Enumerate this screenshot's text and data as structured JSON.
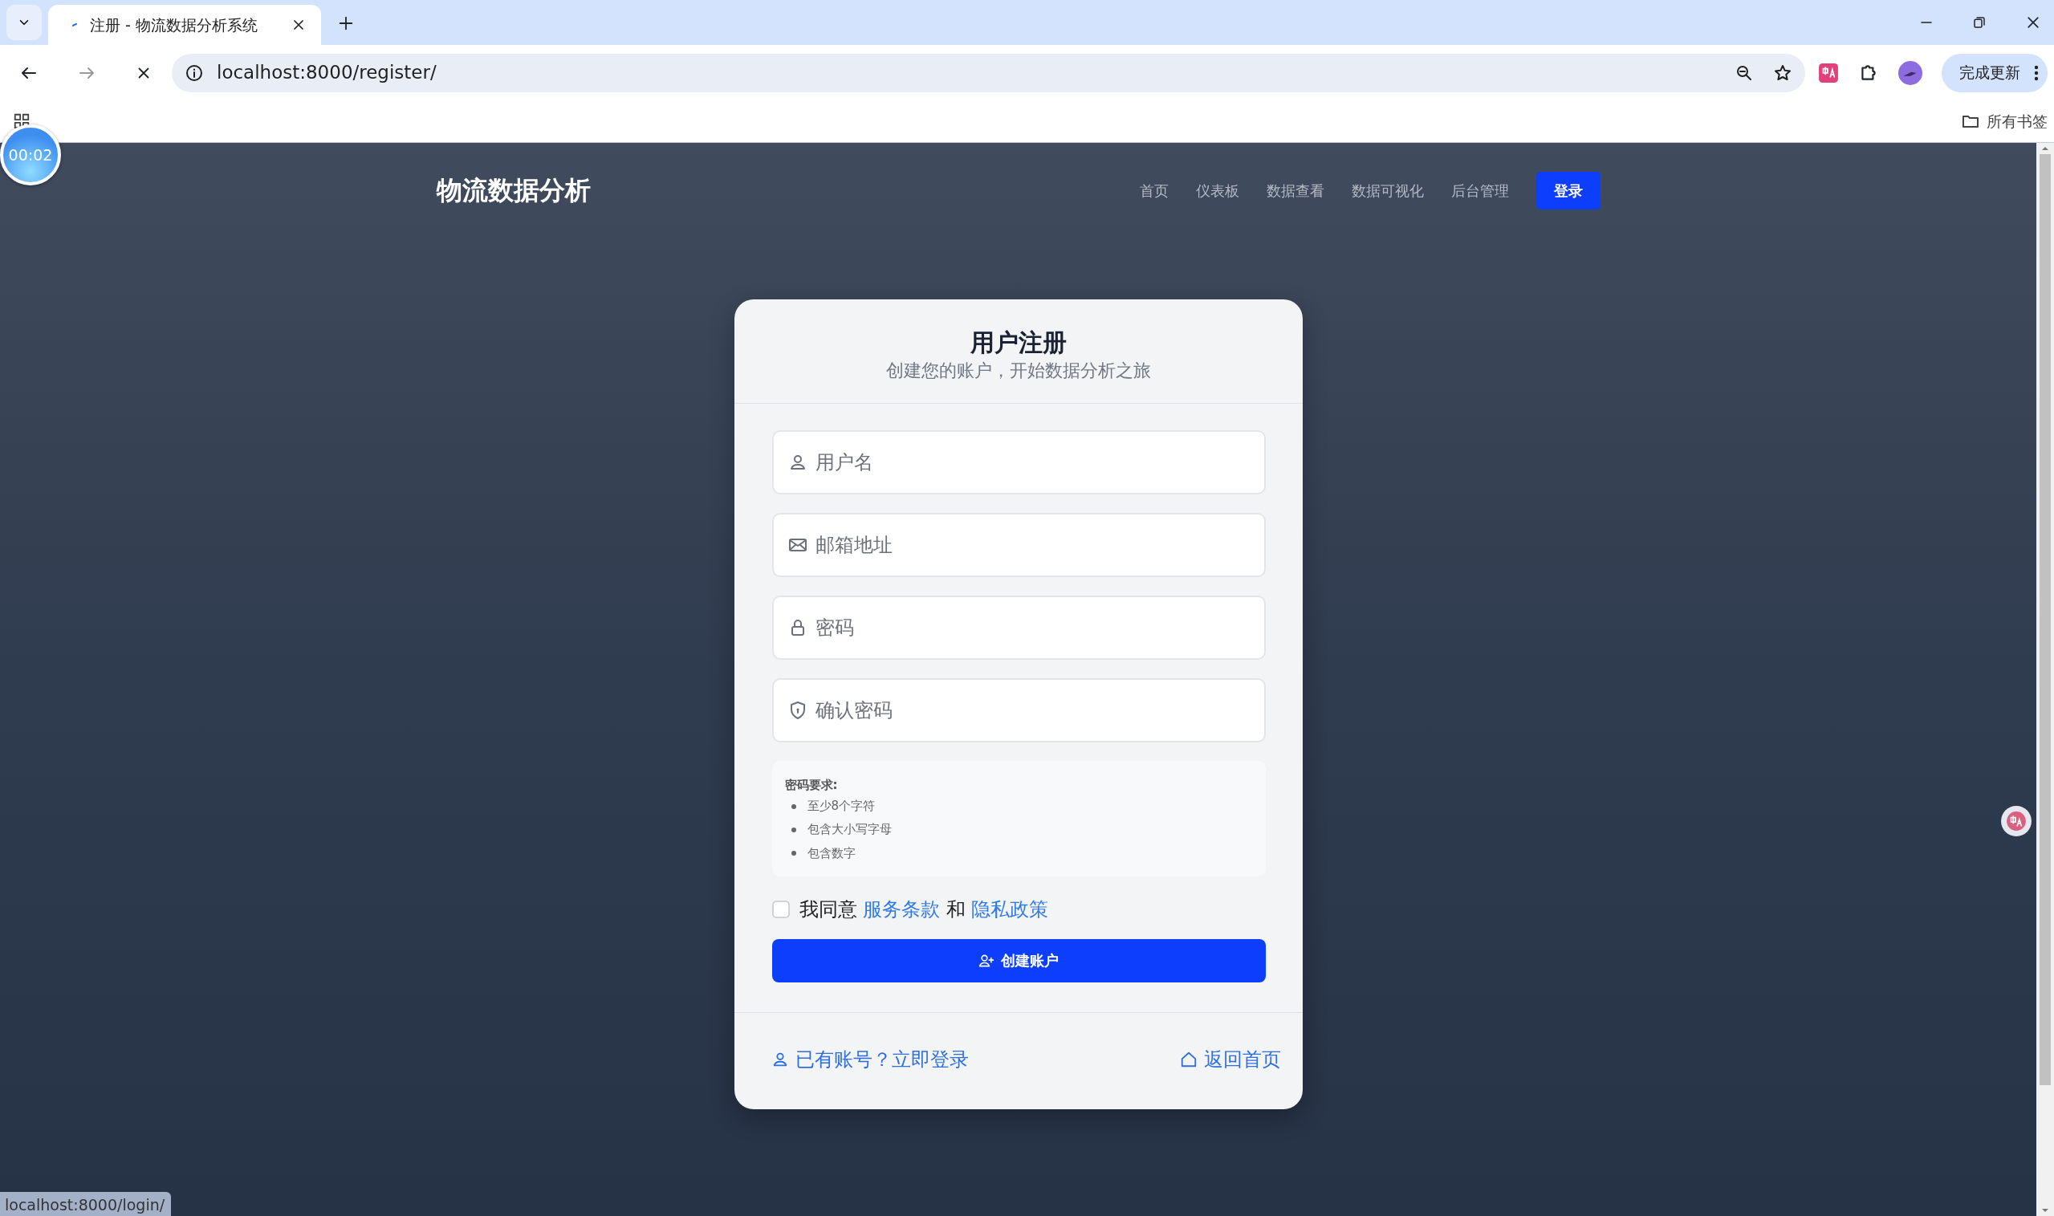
{
  "browser": {
    "tabs": [
      {
        "title": "注册 - 物流数据分析系统",
        "selected": true
      }
    ],
    "address": "localhost:8000/register/",
    "update_button": "完成更新",
    "bookmarks_label": "所有书签",
    "status_url": "localhost:8000/login/"
  },
  "recorder": {
    "time": "00:02"
  },
  "navbar": {
    "brand": "物流数据分析",
    "links": [
      {
        "label": "首页",
        "kind": "link"
      },
      {
        "label": "仪表板",
        "kind": "link"
      },
      {
        "label": "数据查看",
        "kind": "link"
      },
      {
        "label": "数据可视化",
        "kind": "link"
      },
      {
        "label": "后台管理",
        "kind": "link"
      },
      {
        "label": "登录",
        "kind": "button"
      }
    ]
  },
  "card": {
    "title": "用户注册",
    "subtitle": "创建您的账户，开始数据分析之旅",
    "fields": [
      {
        "placeholder": "用户名",
        "kind": "username"
      },
      {
        "placeholder": "邮箱地址",
        "kind": "email"
      },
      {
        "placeholder": "密码",
        "kind": "password"
      },
      {
        "placeholder": "确认密码",
        "kind": "confirm"
      }
    ],
    "requirements": {
      "title": "密码要求:",
      "items": [
        "至少8个字符",
        "包含大小写字母",
        "包含数字"
      ]
    },
    "agree": {
      "checked": false,
      "parts": [
        {
          "text": "我同意",
          "kind": "text"
        },
        {
          "text": "服务条款",
          "kind": "link"
        },
        {
          "text": "和",
          "kind": "text"
        },
        {
          "text": "隐私政策",
          "kind": "link"
        }
      ]
    },
    "submit": "创建账户",
    "footer_links": [
      {
        "label": "已有账号？立即登录",
        "kind": "login"
      },
      {
        "label": "返回首页",
        "kind": "home"
      }
    ]
  }
}
